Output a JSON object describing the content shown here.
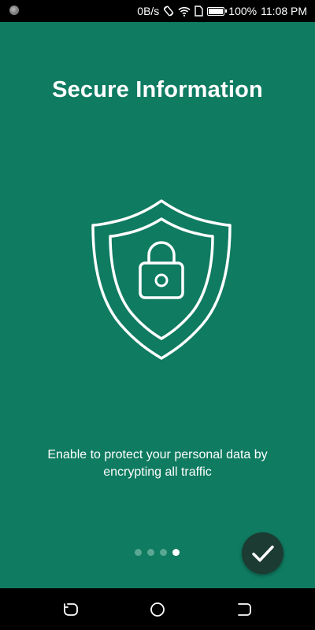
{
  "status_bar": {
    "net_speed": "0B/s",
    "battery_level": "100%",
    "battery_fraction": 1.0,
    "time": "11:08 PM",
    "icons": [
      "notification-dot-icon",
      "rotate-icon",
      "wifi-icon",
      "sim-icon",
      "battery-icon"
    ]
  },
  "onboarding": {
    "title": "Secure Information",
    "illustration": "shield-lock-icon",
    "description": "Enable to protect your personal data by encrypting all traffic",
    "page_indicator": {
      "total": 4,
      "current": 4
    },
    "done_icon": "checkmark-icon"
  },
  "nav_bar": {
    "buttons": [
      "recents-icon",
      "home-icon",
      "back-icon"
    ]
  },
  "colors": {
    "background": "#0f7b61",
    "fab": "#1c3b33",
    "dot_inactive": "#5aa893",
    "foreground": "#ffffff"
  }
}
